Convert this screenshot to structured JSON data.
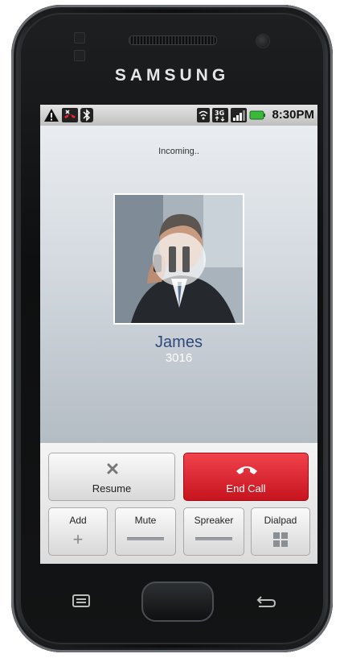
{
  "device": {
    "brand": "SAMSUNG"
  },
  "status_bar": {
    "time": "8:30PM",
    "left_icons": [
      "warning-icon",
      "missed-call-icon",
      "bluetooth-icon"
    ],
    "right_icons": [
      "wifi-icon",
      "3g-data-icon",
      "signal-icon",
      "battery-icon"
    ],
    "battery_color": "#3bb83b"
  },
  "call": {
    "status": "Incoming..",
    "contact_name": "James",
    "contact_number": "3016",
    "state_icon": "pause-icon"
  },
  "buttons": {
    "resume": "Resume",
    "end_call": "End Call",
    "add": "Add",
    "mute": "Mute",
    "speaker": "Spreaker",
    "dialpad": "Dialpad"
  },
  "colors": {
    "end_call": "#d9202b",
    "contact_name": "#2e4a7a"
  }
}
